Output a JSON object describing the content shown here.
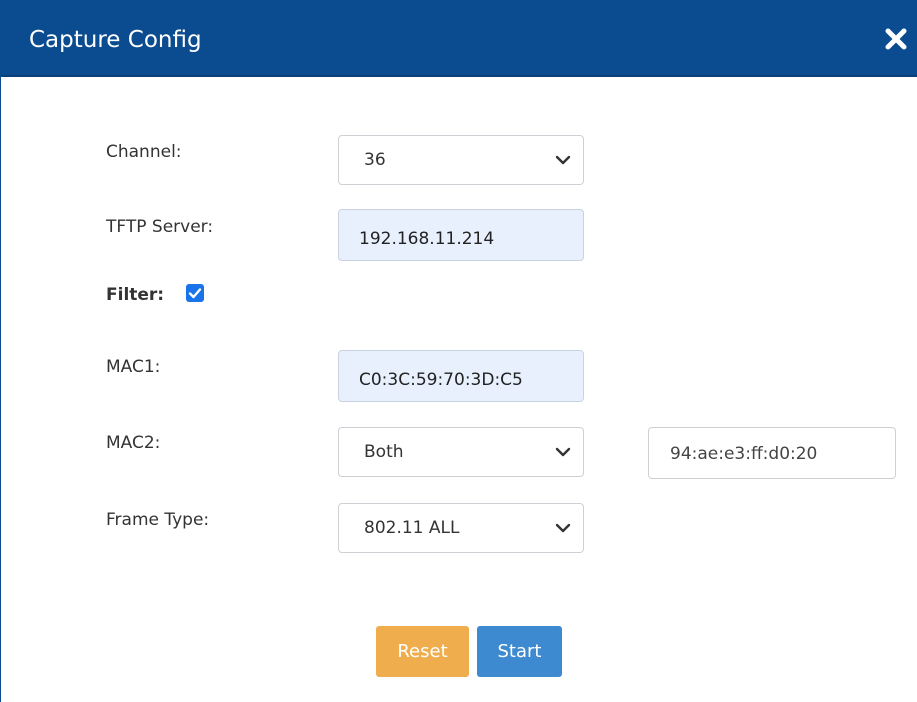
{
  "dialog": {
    "title": "Capture Config",
    "close_icon": "close-icon"
  },
  "form": {
    "channel": {
      "label": "Channel:",
      "value": "36"
    },
    "tftp_server": {
      "label": "TFTP Server:",
      "value": "192.168.11.214"
    },
    "filter": {
      "label": "Filter:",
      "checked": true
    },
    "mac1": {
      "label": "MAC1:",
      "value": "C0:3C:59:70:3D:C5"
    },
    "mac2": {
      "label": "MAC2:",
      "direction": "Both",
      "value": "94:ae:e3:ff:d0:20"
    },
    "frame_type": {
      "label": "Frame Type:",
      "value": "802.11 ALL"
    }
  },
  "buttons": {
    "reset_label": "Reset",
    "start_label": "Start"
  },
  "colors": {
    "title_bar": "#0a4c8f",
    "reset": "#efad4e",
    "start": "#3d8ad0",
    "checkbox": "#1a73e8",
    "autofill_bg": "#e8f0fe"
  }
}
